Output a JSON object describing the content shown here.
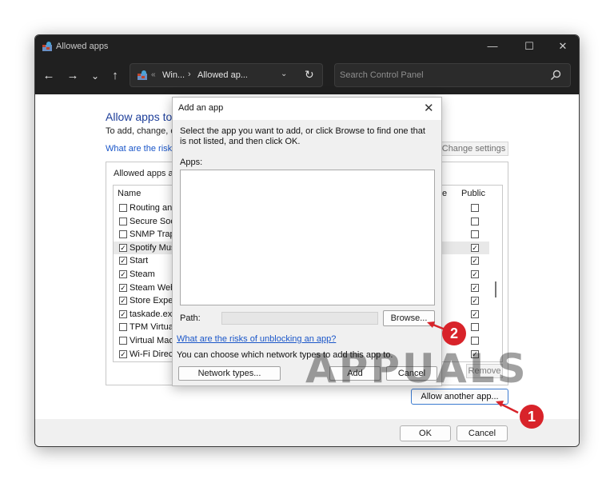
{
  "window": {
    "title": "Allowed apps",
    "controls": {
      "minimize": "—",
      "maximize": "☐",
      "close": "✕"
    }
  },
  "nav": {
    "back": "←",
    "forward": "→",
    "recent": "⌄",
    "up": "↑",
    "breadcrumb": [
      "Win...",
      "Allowed ap..."
    ],
    "breadcrumb_prefix": "«",
    "separator": "›",
    "dropdown": "⌄",
    "refresh": "↻",
    "search_placeholder": "Search Control Panel"
  },
  "main": {
    "heading": "Allow apps to",
    "description": "To add, change, or",
    "risk_link": "What are the risks",
    "change_settings": "Change settings",
    "group_title": "Allowed apps an",
    "columns": {
      "name": "Name",
      "private": "te",
      "public": "Public"
    },
    "rows": [
      {
        "label": "Routing and",
        "checked": false,
        "public": false,
        "highlight": false
      },
      {
        "label": "Secure Socke",
        "checked": false,
        "public": false,
        "highlight": false
      },
      {
        "label": "SNMP Trap",
        "checked": false,
        "public": false,
        "highlight": false
      },
      {
        "label": "Spotify Musi",
        "checked": true,
        "public": true,
        "highlight": true
      },
      {
        "label": "Start",
        "checked": true,
        "public": true,
        "highlight": false
      },
      {
        "label": "Steam",
        "checked": true,
        "public": true,
        "highlight": false
      },
      {
        "label": "Steam Web H",
        "checked": true,
        "public": true,
        "highlight": false
      },
      {
        "label": "Store Experie",
        "checked": true,
        "public": true,
        "highlight": false
      },
      {
        "label": "taskade.exe",
        "checked": true,
        "public": true,
        "highlight": false
      },
      {
        "label": "TPM Virtual",
        "checked": false,
        "public": false,
        "highlight": false
      },
      {
        "label": "Virtual Mach",
        "checked": false,
        "public": false,
        "highlight": false
      },
      {
        "label": "Wi-Fi Direct",
        "checked": true,
        "public": true,
        "highlight": false
      }
    ],
    "remove": "Remove",
    "allow_another": "Allow another app...",
    "ok": "OK",
    "cancel": "Cancel"
  },
  "dialog": {
    "title": "Add an app",
    "close": "✕",
    "intro": "Select the app you want to add, or click Browse to find one that is not listed, and then click OK.",
    "apps_label": "Apps:",
    "path_label": "Path:",
    "path_value": "",
    "browse": "Browse...",
    "risk_link": "What are the risks of unblocking an app?",
    "network_text": "You can choose which network types to add this app to.",
    "network_types": "Network types...",
    "add": "Add",
    "cancel": "Cancel"
  },
  "annotations": {
    "badge1": "1",
    "badge2": "2",
    "accent_color": "#d8232a"
  },
  "watermark": "APPUALS"
}
